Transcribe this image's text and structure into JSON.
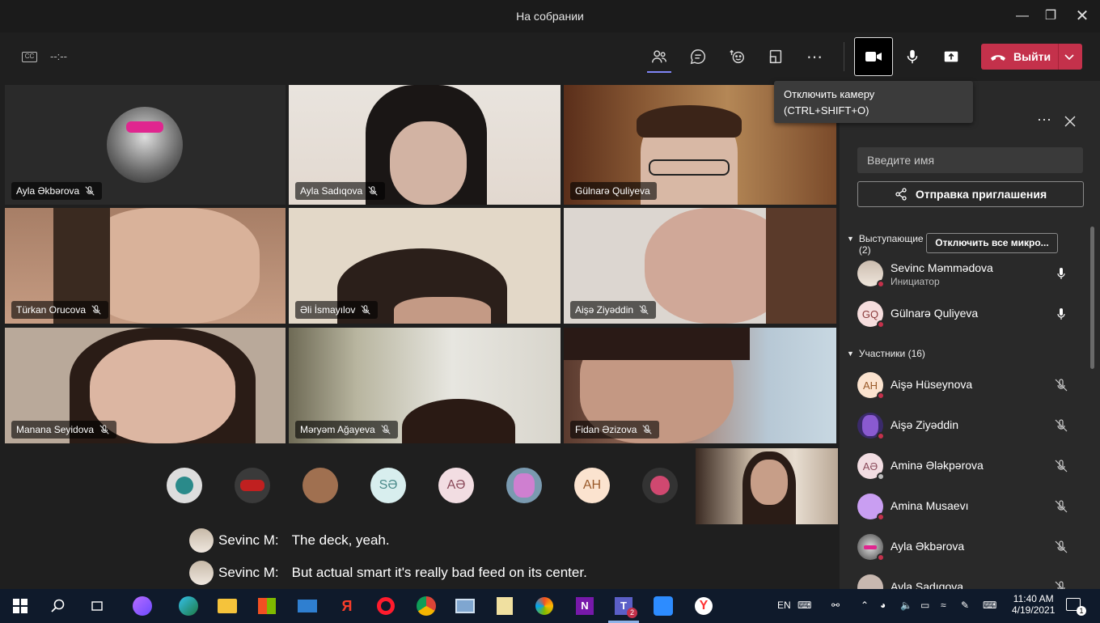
{
  "window": {
    "title": "На собрании"
  },
  "toolbar": {
    "timer": "--:--",
    "leave_label": "Выйти",
    "cc_label": "CC"
  },
  "tooltip": {
    "line1": "Отключить камеру",
    "line2": "(CTRL+SHIFT+O)"
  },
  "tiles": [
    {
      "name": "Ayla Əkbərova"
    },
    {
      "name": "Ayla Sadıqova"
    },
    {
      "name": "Gülnarə Quliyeva"
    },
    {
      "name": "Türkan Orucova"
    },
    {
      "name": "Əli İsmayılov"
    },
    {
      "name": "Aişə Ziyəddin"
    },
    {
      "name": "Manana Seyidova"
    },
    {
      "name": "Məryəm Ağayeva"
    },
    {
      "name": "Fidan Əzizova"
    }
  ],
  "avatars": [
    {
      "initials": ""
    },
    {
      "initials": ""
    },
    {
      "initials": ""
    },
    {
      "initials": "SƏ"
    },
    {
      "initials": "AƏ"
    },
    {
      "initials": ""
    },
    {
      "initials": "AH"
    },
    {
      "initials": ""
    }
  ],
  "captions": [
    {
      "speaker": "Sevinc M:",
      "text": "The deck, yeah."
    },
    {
      "speaker": "Sevinc M:",
      "text": "But actual smart it's really bad feed on its center."
    }
  ],
  "panel": {
    "search_placeholder": "Введите имя",
    "invite_label": "Отправка приглашения",
    "presenters_label": "Выступающие",
    "presenters_count": "(2)",
    "mute_all_label": "Отключить все микро...",
    "attendees_label": "Участники (16)",
    "presenters": [
      {
        "name": "Sevinc Məmmədova",
        "role": "Инициатор",
        "initials": ""
      },
      {
        "name": "Gülnarə Quliyeva",
        "role": "",
        "initials": "GQ"
      }
    ],
    "attendees": [
      {
        "name": "Aişə Hüseynova",
        "initials": "AH"
      },
      {
        "name": "Aişə Ziyəddin",
        "initials": ""
      },
      {
        "name": "Aminə Ələkpərova",
        "initials": "AƏ"
      },
      {
        "name": "Amina Musaevı",
        "initials": ""
      },
      {
        "name": "Ayla Əkbərova",
        "initials": ""
      },
      {
        "name": "Ayla Sadıqova",
        "initials": ""
      }
    ]
  },
  "taskbar": {
    "lang": "EN",
    "time": "11:40 AM",
    "date": "4/19/2021",
    "teams_badge": "2",
    "notif_count": "1"
  },
  "colors": {
    "leave": "#c4314b",
    "accent": "#7f85f5",
    "mute_dot": "#c4314b"
  }
}
